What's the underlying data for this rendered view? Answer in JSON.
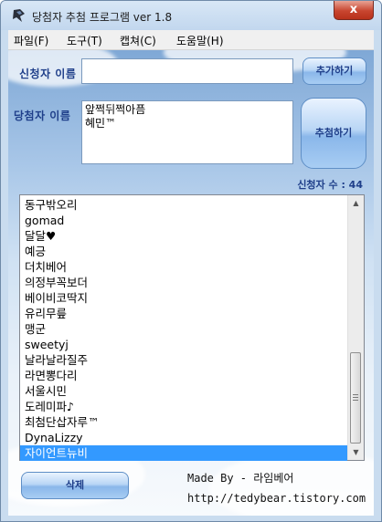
{
  "window": {
    "title": "당첨자 추첨 프로그램 ver 1.8",
    "close_label": "x"
  },
  "menu": [
    {
      "label": "파일(F)"
    },
    {
      "label": "도구(T)"
    },
    {
      "label": "캡쳐(C)"
    },
    {
      "label": "도움말(H)"
    }
  ],
  "form": {
    "applicant_name_label": "신청자 이름",
    "applicant_name_value": "",
    "add_button_label": "추가하기",
    "winner_name_label": "당첨자 이름",
    "winners": [
      "앞쩍뒤쩍아픔",
      "혜민™"
    ],
    "draw_button_label": "추첨하기",
    "applicant_count_text": "신청자 수 : 44"
  },
  "list": {
    "items": [
      "동구밖오리",
      "gomad",
      "달달♥",
      "예긍",
      "더치베어",
      "의정부꼭보더",
      "베이비코딱지",
      "유리무릎",
      "맹군",
      "sweetyj",
      "날라날라질주",
      "라면뽕다리",
      "서울시민",
      "도레미파♪",
      "최첨단삽자루™",
      "DynaLizzy",
      "자이언트뉴비"
    ],
    "selected_index": 16
  },
  "footer": {
    "delete_button_label": "삭제",
    "made_by": "Made By - 라임베어",
    "url": "http://tedybear.tistory.com"
  }
}
